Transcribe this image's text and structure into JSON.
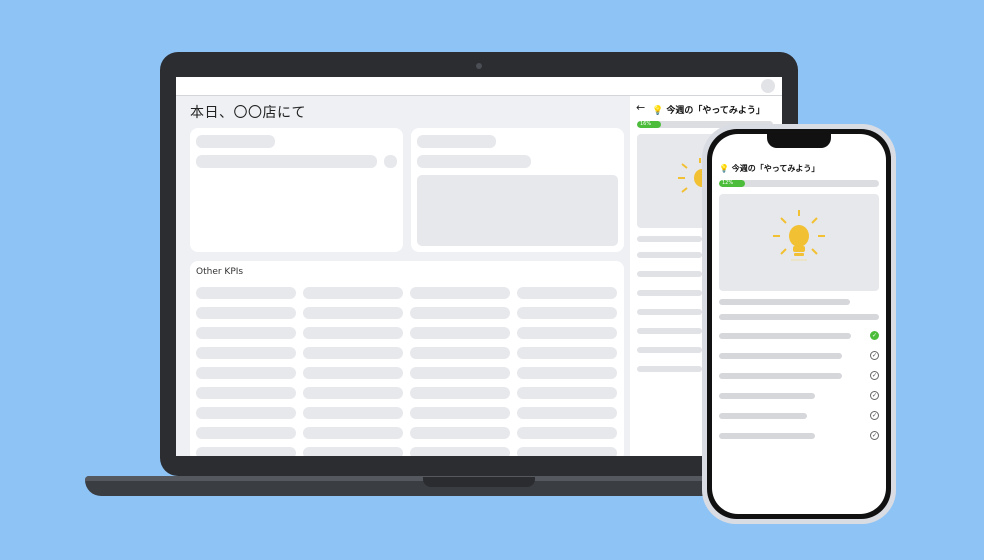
{
  "desktop": {
    "page_title": "本日、〇〇店にて",
    "kpi_section_title": "Other KPIs",
    "panel": {
      "back_icon": "arrow-left-icon",
      "title": "💡 今週の「やってみよう」",
      "progress_label": "16%",
      "progress": 0.16
    }
  },
  "mobile": {
    "title": "💡 今週の「やってみよう」",
    "progress_label": "12%",
    "progress": 0.12,
    "image_icon": "lightbulb-icon",
    "tasks": [
      {
        "done": true,
        "icon": "check-circle-icon",
        "mark": "✓"
      },
      {
        "done": false,
        "icon": "check-circle-icon",
        "mark": "✓"
      },
      {
        "done": false,
        "icon": "check-circle-icon",
        "mark": "✓"
      },
      {
        "done": false,
        "icon": "check-circle-icon",
        "mark": "✓"
      },
      {
        "done": false,
        "icon": "check-circle-icon",
        "mark": "✓"
      },
      {
        "done": false,
        "icon": "check-circle-icon",
        "mark": "✓"
      }
    ]
  },
  "colors": {
    "background": "#8ec3f6",
    "progress": "#4cbd3b",
    "bulb": "#f2c033",
    "skeleton": "#e7e8ec"
  }
}
